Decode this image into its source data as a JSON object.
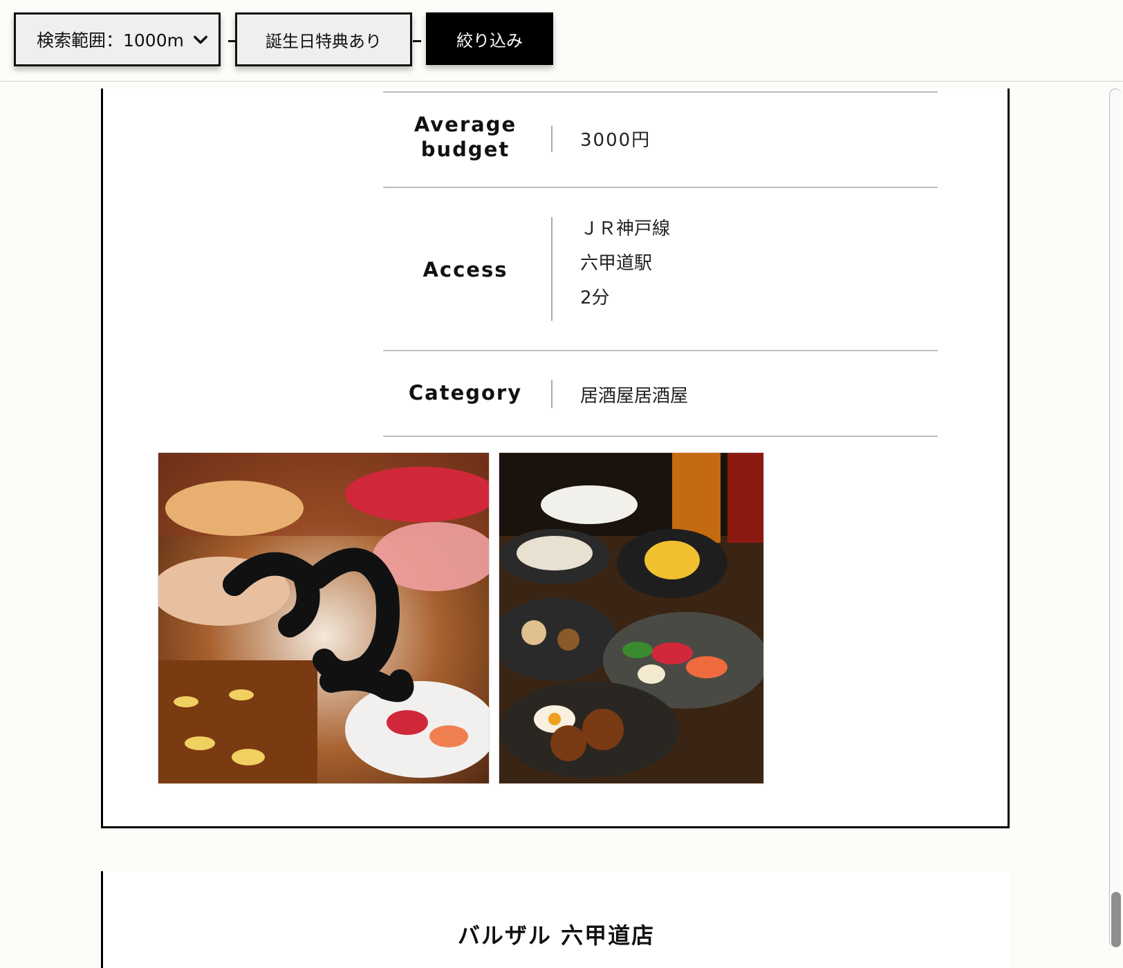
{
  "filter": {
    "range_label": "検索範囲：1000m",
    "birthday_label": "誕生日特典あり",
    "submit_label": "絞り込み"
  },
  "shop": {
    "budget_label": "Average budget",
    "budget_value": "3000円",
    "access_label": "Access",
    "access_lines": [
      "ＪＲ神戸線",
      "六甲道駅",
      "2分"
    ],
    "category_label": "Category",
    "category_value": "居酒屋居酒屋",
    "photos": [
      "shop-photo-main",
      "shop-photo-course"
    ]
  },
  "next_shop": {
    "name": "バルザル 六甲道店"
  },
  "colors": {
    "accent": "#000000",
    "button_bg": "#efefef",
    "divider": "#bdbdbd"
  }
}
